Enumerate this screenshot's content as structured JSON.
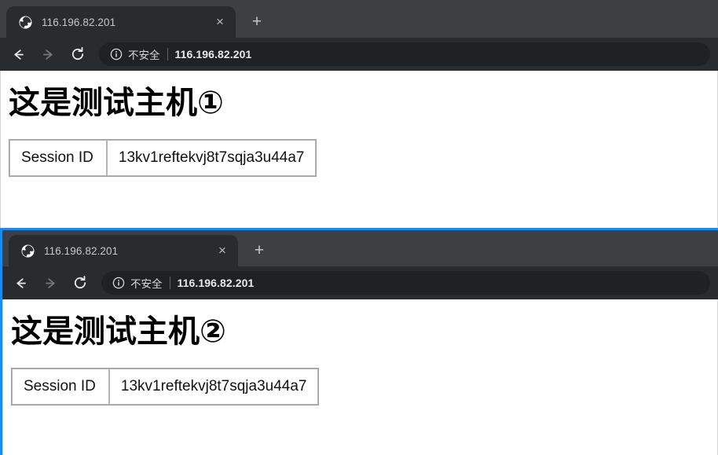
{
  "colors": {
    "tabstrip_bg": "#3c4043",
    "toolbar_bg": "#292c2f",
    "omnibox_bg": "#1f2224",
    "window_focus_border": "#1a8cf0",
    "page_bg": "#ffffff",
    "heading_color": "#000000",
    "table_border": "#b5b5b5"
  },
  "windows": [
    {
      "tab": {
        "favicon": "globe-icon",
        "title": "116.196.82.201",
        "close_label": "×"
      },
      "new_tab_label": "+",
      "toolbar": {
        "back_label": "←",
        "forward_label": "→",
        "reload_label": "↻",
        "security_icon": "info-circle-icon",
        "security_text": "不安全",
        "url": "116.196.82.201"
      },
      "page": {
        "heading": "这是测试主机①",
        "table": {
          "label": "Session ID",
          "value": "13kv1reftekvj8t7sqja3u44a7"
        }
      }
    },
    {
      "tab": {
        "favicon": "globe-icon",
        "title": "116.196.82.201",
        "close_label": "×"
      },
      "new_tab_label": "+",
      "toolbar": {
        "back_label": "←",
        "forward_label": "→",
        "reload_label": "↻",
        "security_icon": "info-circle-icon",
        "security_text": "不安全",
        "url": "116.196.82.201"
      },
      "page": {
        "heading": "这是测试主机②",
        "table": {
          "label": "Session ID",
          "value": "13kv1reftekvj8t7sqja3u44a7"
        }
      }
    }
  ]
}
